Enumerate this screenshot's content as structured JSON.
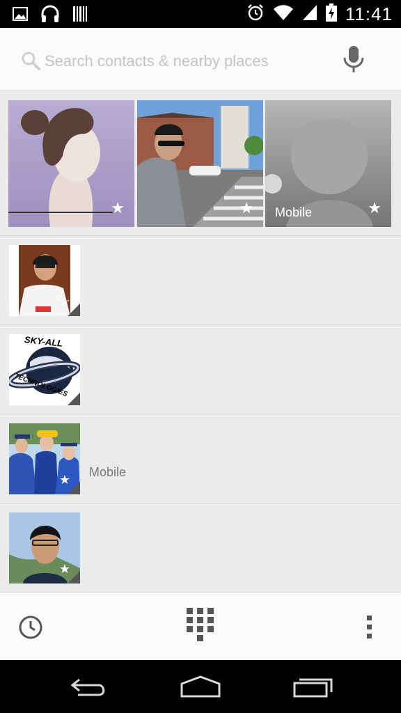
{
  "status_bar": {
    "time": "11:41",
    "left_icons": [
      "image-notification-icon",
      "headphones-icon",
      "barcode-icon"
    ],
    "right_icons": [
      "alarm-icon",
      "wifi-icon",
      "signal-icon",
      "battery-charging-icon"
    ]
  },
  "search": {
    "placeholder": "Search contacts & nearby places",
    "value": "",
    "voice_icon": "microphone-icon"
  },
  "favorites": [
    {
      "label": "",
      "starred": true
    },
    {
      "label": "",
      "starred": true
    },
    {
      "label": "Mobile",
      "starred": true
    }
  ],
  "contacts": [
    {
      "name": "",
      "subtitle": "",
      "starred": true
    },
    {
      "name": "",
      "subtitle": "",
      "starred": false,
      "photo_text": "SKY-ALL TECHNOLOGIES"
    },
    {
      "name": "",
      "subtitle": "Mobile",
      "starred": true
    },
    {
      "name": "",
      "subtitle": "",
      "starred": true
    }
  ],
  "bottom_actions": [
    "recents-clock-icon",
    "dialpad-icon",
    "overflow-menu-icon"
  ],
  "nav_buttons": [
    "back-icon",
    "home-icon",
    "recent-apps-icon"
  ],
  "colors": {
    "accent": "#33b5e5",
    "background": "#ebebeb",
    "bar": "#fafafa"
  }
}
